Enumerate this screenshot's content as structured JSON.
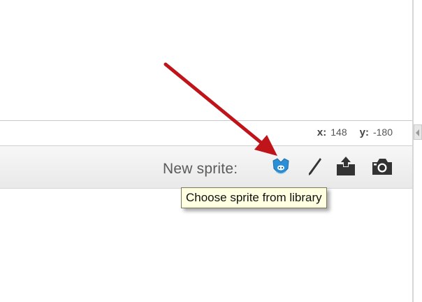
{
  "coords": {
    "x_label": "x:",
    "x_value": "148",
    "y_label": "y:",
    "y_value": "-180"
  },
  "sprite_pane": {
    "new_sprite_label": "New sprite:",
    "icons": [
      "sprite-library-icon",
      "paint-brush-icon",
      "upload-icon",
      "camera-icon"
    ]
  },
  "tooltip": {
    "text": "Choose sprite from library"
  },
  "colors": {
    "annotation_arrow": "#c0141b",
    "sprite_library_icon": "#2a8fd6",
    "tooltip_bg": "#ffffe1"
  }
}
